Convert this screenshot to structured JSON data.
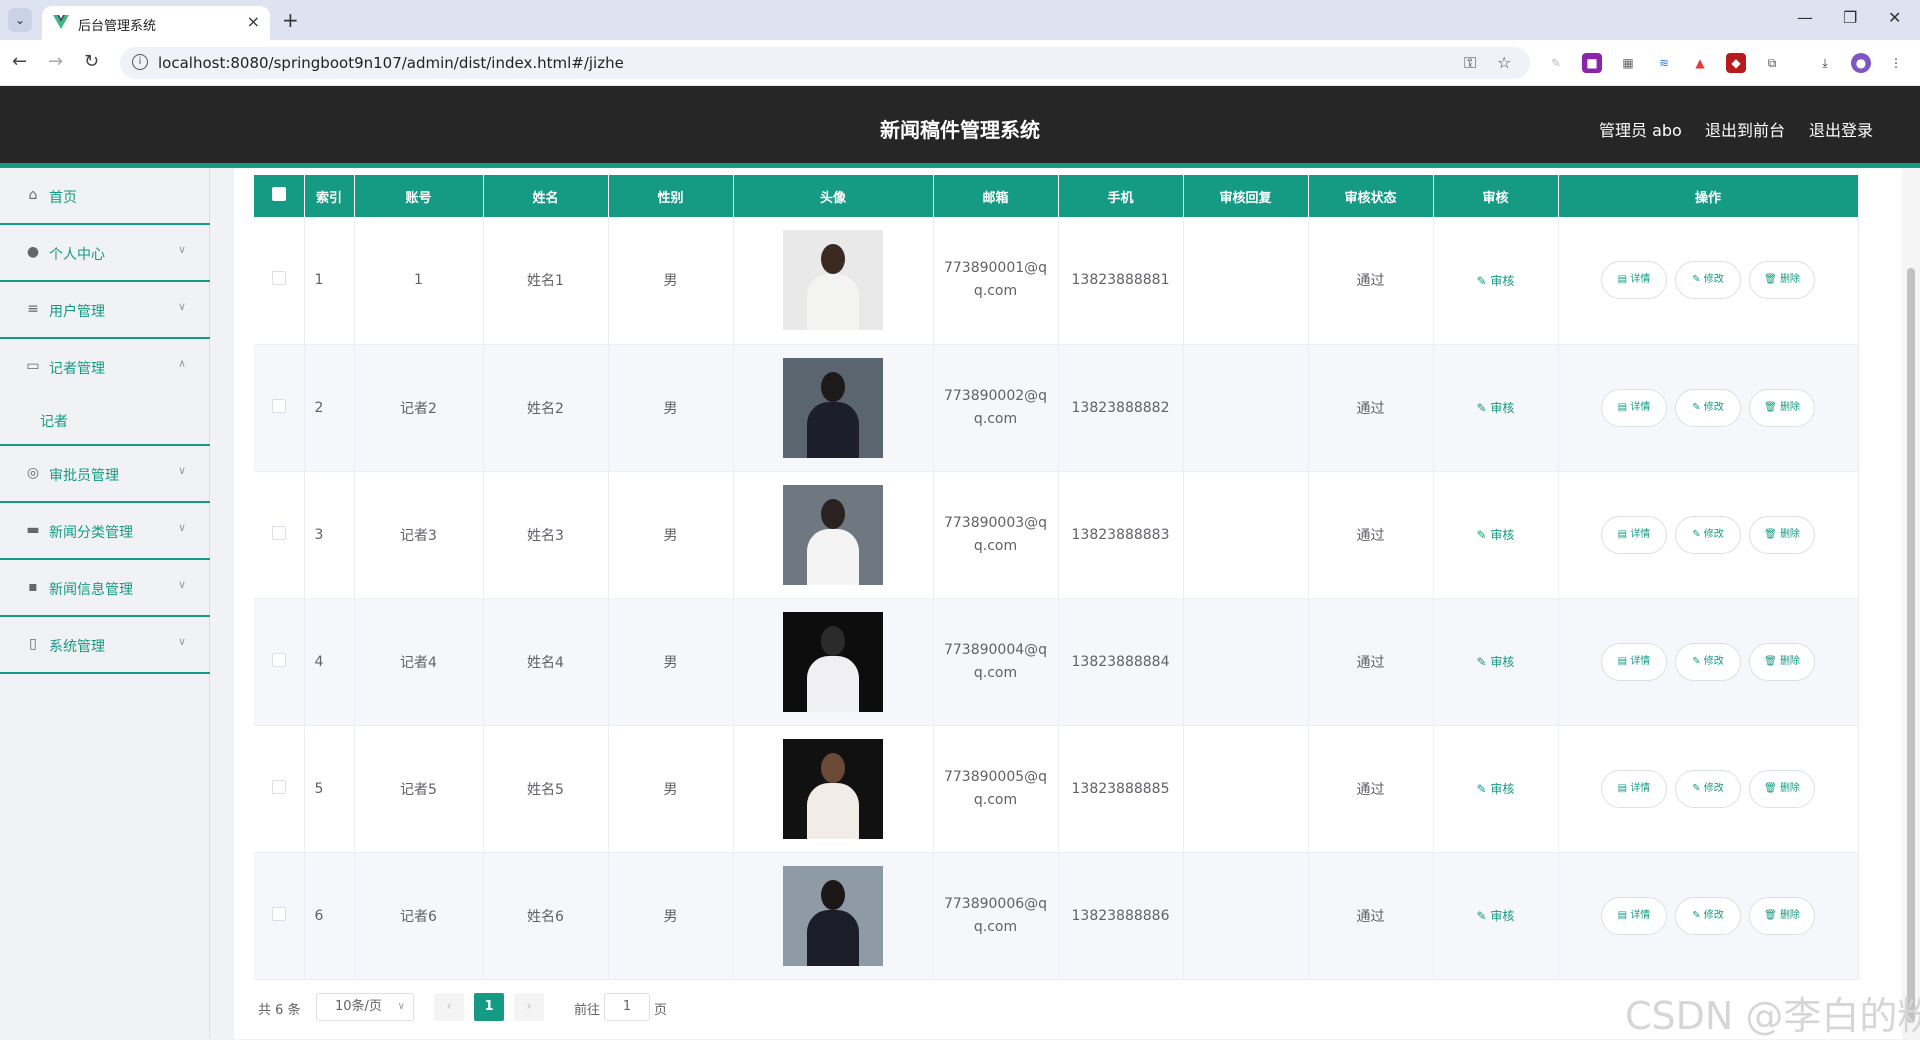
{
  "browser": {
    "tab_title": "后台管理系统",
    "url": "localhost:8080/springboot9n107/admin/dist/index.html#/jizhe"
  },
  "header": {
    "title": "新闻稿件管理系统",
    "user_label": "管理员 abo",
    "to_front": "退出到前台",
    "logout": "退出登录"
  },
  "sidebar": {
    "items": [
      {
        "label": "首页",
        "icon": "home-icon"
      },
      {
        "label": "个人中心",
        "icon": "user-icon"
      },
      {
        "label": "用户管理",
        "icon": "list-icon"
      },
      {
        "label": "记者管理",
        "icon": "card-icon"
      },
      {
        "label": "审批员管理",
        "icon": "compass-icon"
      },
      {
        "label": "新闻分类管理",
        "icon": "briefcase-icon"
      },
      {
        "label": "新闻信息管理",
        "icon": "chat-icon"
      },
      {
        "label": "系统管理",
        "icon": "phone-icon"
      }
    ],
    "sub_item": "记者"
  },
  "table": {
    "headers": [
      "索引",
      "账号",
      "姓名",
      "性别",
      "头像",
      "邮箱",
      "手机",
      "审核回复",
      "审核状态",
      "审核",
      "操作"
    ],
    "audit_label": "审核",
    "op_labels": [
      "详情",
      "修改",
      "删除"
    ],
    "rows": [
      {
        "index": "1",
        "account": "1",
        "name": "姓名1",
        "gender": "男",
        "email": "773890001@qq.com",
        "phone": "13823888881",
        "reply": "",
        "status": "通过"
      },
      {
        "index": "2",
        "account": "记者2",
        "name": "姓名2",
        "gender": "男",
        "email": "773890002@qq.com",
        "phone": "13823888882",
        "reply": "",
        "status": "通过"
      },
      {
        "index": "3",
        "account": "记者3",
        "name": "姓名3",
        "gender": "男",
        "email": "773890003@qq.com",
        "phone": "13823888883",
        "reply": "",
        "status": "通过"
      },
      {
        "index": "4",
        "account": "记者4",
        "name": "姓名4",
        "gender": "男",
        "email": "773890004@qq.com",
        "phone": "13823888884",
        "reply": "",
        "status": "通过"
      },
      {
        "index": "5",
        "account": "记者5",
        "name": "姓名5",
        "gender": "男",
        "email": "773890005@qq.com",
        "phone": "13823888885",
        "reply": "",
        "status": "通过"
      },
      {
        "index": "6",
        "account": "记者6",
        "name": "姓名6",
        "gender": "男",
        "email": "773890006@qq.com",
        "phone": "13823888886",
        "reply": "",
        "status": "通过"
      }
    ]
  },
  "pagination": {
    "total": "共 6 条",
    "page_size": "10条/页",
    "current": "1",
    "goto_label": "前往",
    "goto_value": "1",
    "page_suffix": "页"
  },
  "watermark": "CSDN @李白的粉",
  "colors": {
    "accent": "#159a83",
    "header_bg": "#262626"
  }
}
